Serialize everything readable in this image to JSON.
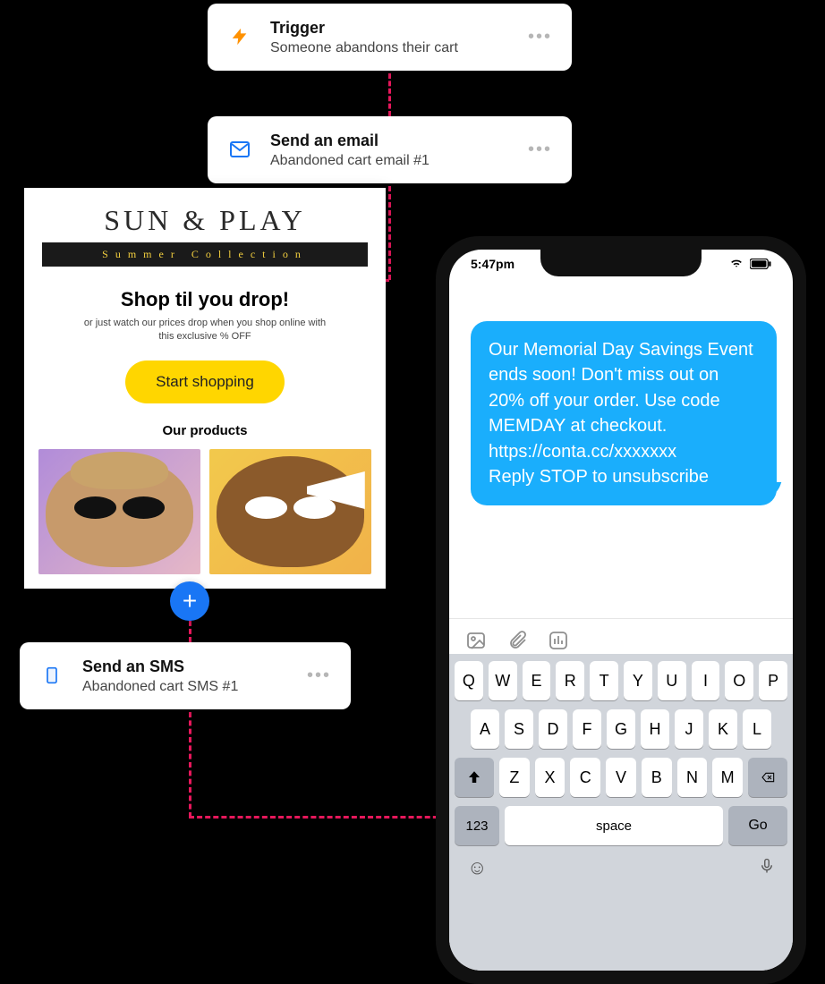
{
  "flow": {
    "trigger": {
      "title": "Trigger",
      "subtitle": "Someone abandons their cart",
      "icon": "lightning-bolt-icon",
      "more": "•••"
    },
    "email_step": {
      "title": "Send an email",
      "subtitle": "Abandoned cart email #1",
      "icon": "envelope-icon",
      "more": "•••"
    },
    "sms_step": {
      "title": "Send an SMS",
      "subtitle": "Abandoned cart SMS #1",
      "icon": "phone-icon",
      "more": "•••"
    },
    "add_button": "+"
  },
  "email_preview": {
    "brand": "SUN & PLAY",
    "brand_bar": "Summer Collection",
    "headline": "Shop til you drop!",
    "subtext_line1": "or just watch our prices drop when you shop online with",
    "subtext_line2": "this exclusive % OFF",
    "cta": "Start shopping",
    "products_heading": "Our products"
  },
  "phone": {
    "time": "5:47pm",
    "sms_body": "Our Memorial Day Savings Event ends soon! Don't miss out on 20% off your order. Use code MEMDAY at checkout. https://conta.cc/xxxxxxx\nReply STOP to unsubscribe",
    "keyboard": {
      "row1": [
        "Q",
        "W",
        "E",
        "R",
        "T",
        "Y",
        "U",
        "I",
        "O",
        "P"
      ],
      "row2": [
        "A",
        "S",
        "D",
        "F",
        "G",
        "H",
        "J",
        "K",
        "L"
      ],
      "row3": [
        "Z",
        "X",
        "C",
        "V",
        "B",
        "N",
        "M"
      ],
      "num_key": "123",
      "space_key": "space",
      "go_key": "Go"
    }
  }
}
